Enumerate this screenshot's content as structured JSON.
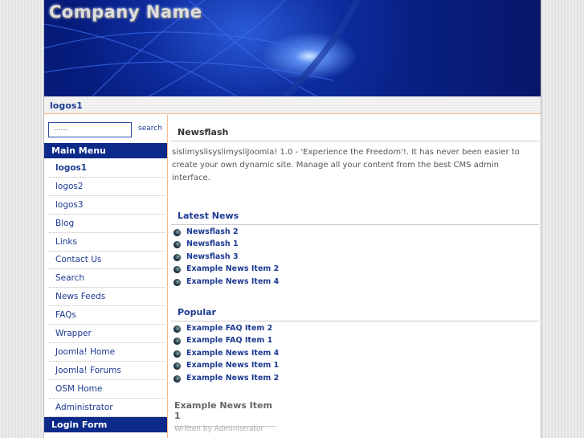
{
  "header": {
    "logo": "Company Name"
  },
  "breadcrumb": "logos1",
  "search": {
    "placeholder": "......",
    "button": "search"
  },
  "main_menu": {
    "title": "Main Menu",
    "items": [
      "logos1",
      "logos2",
      "logos3",
      "Blog",
      "Links",
      "Contact Us",
      "Search",
      "News Feeds",
      "FAQs",
      "Wrapper",
      "Joomla! Home",
      "Joomla! Forums",
      "OSM Home",
      "Administrator"
    ]
  },
  "login_form": {
    "title": "Login Form"
  },
  "newsflash": {
    "title": "Newsflash",
    "text": "sislimyslisyslimysliJoomla! 1.0 - 'Experience the Freedom'!. It has never been easier to create your own dynamic site. Manage all your content from the best CMS admin interface."
  },
  "latest_news": {
    "title": "Latest News",
    "items": [
      "Newsflash 2",
      "Newsflash 1",
      "Newsflash 3",
      "Example News Item 2",
      "Example News Item 4"
    ]
  },
  "popular": {
    "title": "Popular",
    "items": [
      "Example FAQ Item 2",
      "Example FAQ Item 1",
      "Example News Item 4",
      "Example News Item 1",
      "Example News Item 2"
    ]
  },
  "article": {
    "title": "Example News Item 1",
    "byline": "Written by Administrator"
  }
}
